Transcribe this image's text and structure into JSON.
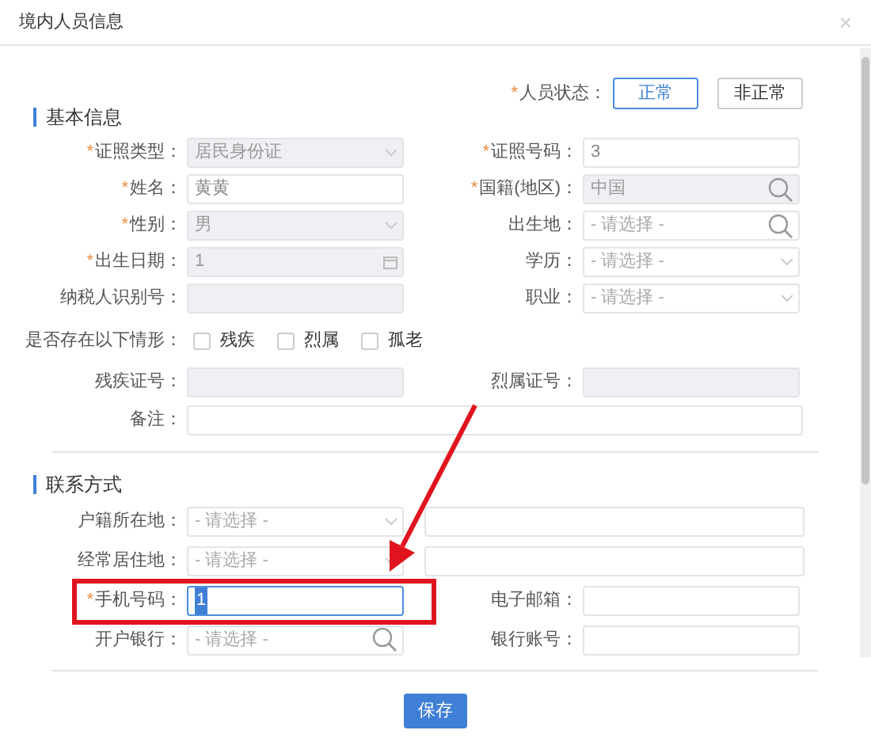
{
  "window": {
    "title": "境内人员信息",
    "close": "×"
  },
  "status": {
    "label": "人员状态：",
    "required_mark": "*",
    "options": [
      {
        "label": "正常",
        "selected": true
      },
      {
        "label": "非正常",
        "selected": false
      }
    ]
  },
  "sections": [
    {
      "title": "基本信息",
      "rows": [
        {
          "fields": [
            {
              "label": "证照类型：",
              "required_mark": "*",
              "kind": "select",
              "value": "居民身份证",
              "disabled": true
            },
            {
              "label": "证照号码：",
              "required_mark": "*",
              "kind": "text",
              "value": "3",
              "disabled": false
            }
          ]
        },
        {
          "fields": [
            {
              "label": "姓名：",
              "required_mark": "*",
              "kind": "text",
              "value": "黄黄",
              "disabled": false
            },
            {
              "label": "国籍(地区)：",
              "required_mark": "*",
              "kind": "search",
              "value": "中国",
              "disabled": true
            }
          ]
        },
        {
          "fields": [
            {
              "label": "性别：",
              "required_mark": "*",
              "kind": "select",
              "value": "男",
              "disabled": true
            },
            {
              "label": "出生地：",
              "kind": "search",
              "placeholder": "- 请选择 -",
              "disabled": false
            }
          ]
        },
        {
          "fields": [
            {
              "label": "出生日期：",
              "required_mark": "*",
              "kind": "date",
              "value": "1",
              "disabled": true
            },
            {
              "label": "学历：",
              "kind": "select",
              "placeholder": "- 请选择 -",
              "disabled": false
            }
          ]
        },
        {
          "fields": [
            {
              "label": "纳税人识别号：",
              "kind": "text",
              "disabled": true
            },
            {
              "label": "职业：",
              "kind": "select",
              "placeholder": "- 请选择 -",
              "disabled": false
            }
          ]
        },
        {
          "fields": [
            {
              "label": "是否存在以下情形：",
              "kind": "checkboxes",
              "options": [
                {
                  "label": "残疾",
                  "checked": false
                },
                {
                  "label": "烈属",
                  "checked": false
                },
                {
                  "label": "孤老",
                  "checked": false
                }
              ]
            }
          ]
        },
        {
          "fields": [
            {
              "label": "残疾证号：",
              "kind": "text",
              "disabled": true
            },
            {
              "label": "烈属证号：",
              "kind": "text",
              "disabled": true
            }
          ]
        },
        {
          "fields": [
            {
              "label": "备注：",
              "kind": "wide-text",
              "disabled": false
            }
          ]
        }
      ]
    },
    {
      "title": "联系方式",
      "rows": [
        {
          "fields": [
            {
              "label": "户籍所在地：",
              "kind": "select",
              "placeholder": "- 请选择 -",
              "disabled": false
            },
            {
              "kind": "address-text",
              "disabled": false
            }
          ]
        },
        {
          "fields": [
            {
              "label": "经常居住地：",
              "kind": "select",
              "placeholder": "- 请选择 -",
              "disabled": false
            },
            {
              "kind": "address-text",
              "disabled": false
            }
          ]
        },
        {
          "fields": [
            {
              "label": "手机号码：",
              "required_mark": "*",
              "kind": "text",
              "value": "1",
              "focused": true,
              "disabled": false
            },
            {
              "label": "电子邮箱：",
              "kind": "text",
              "focused": false,
              "disabled": false
            }
          ]
        },
        {
          "fields": [
            {
              "label": "开户银行：",
              "kind": "search",
              "placeholder": "- 请选择 -",
              "disabled": false
            },
            {
              "label": "银行账号：",
              "kind": "text",
              "disabled": false
            }
          ]
        }
      ]
    }
  ],
  "save_button": "保存"
}
